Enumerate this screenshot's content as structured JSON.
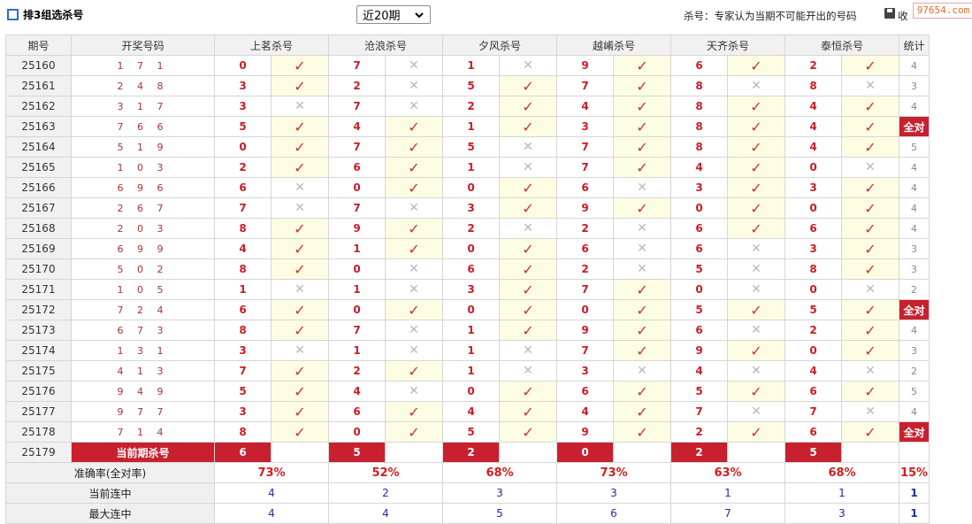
{
  "header": {
    "title": "排3组选杀号",
    "period_select": "近20期",
    "note": "杀号：专家认为当期不可能开出的号码",
    "truncated_text": "收",
    "watermark": "97654.com"
  },
  "table": {
    "col_issue": "期号",
    "col_draw": "开奖号码",
    "experts": [
      "上茗杀号",
      "沧浪杀号",
      "夕风杀号",
      "越崤杀号",
      "天齐杀号",
      "泰恒杀号"
    ],
    "col_stat": "统计",
    "rows": [
      {
        "issue": "25160",
        "draw": "1 7 1",
        "kills": [
          "0",
          "7",
          "1",
          "9",
          "6",
          "2"
        ],
        "ok": [
          true,
          false,
          false,
          true,
          true,
          true
        ],
        "stat": "4"
      },
      {
        "issue": "25161",
        "draw": "2 4 8",
        "kills": [
          "3",
          "2",
          "5",
          "7",
          "8",
          "8"
        ],
        "ok": [
          true,
          false,
          true,
          true,
          false,
          false
        ],
        "stat": "3"
      },
      {
        "issue": "25162",
        "draw": "3 1 7",
        "kills": [
          "3",
          "7",
          "2",
          "4",
          "8",
          "4"
        ],
        "ok": [
          false,
          false,
          true,
          true,
          true,
          true
        ],
        "stat": "4"
      },
      {
        "issue": "25163",
        "draw": "7 6 6",
        "kills": [
          "5",
          "4",
          "1",
          "3",
          "8",
          "4"
        ],
        "ok": [
          true,
          true,
          true,
          true,
          true,
          true
        ],
        "stat": "全对"
      },
      {
        "issue": "25164",
        "draw": "5 1 9",
        "kills": [
          "0",
          "7",
          "5",
          "7",
          "8",
          "4"
        ],
        "ok": [
          true,
          true,
          false,
          true,
          true,
          true
        ],
        "stat": "5"
      },
      {
        "issue": "25165",
        "draw": "1 0 3",
        "kills": [
          "2",
          "6",
          "1",
          "7",
          "4",
          "0"
        ],
        "ok": [
          true,
          true,
          false,
          true,
          true,
          false
        ],
        "stat": "4"
      },
      {
        "issue": "25166",
        "draw": "6 9 6",
        "kills": [
          "6",
          "0",
          "0",
          "6",
          "3",
          "3"
        ],
        "ok": [
          false,
          true,
          true,
          false,
          true,
          true
        ],
        "stat": "4"
      },
      {
        "issue": "25167",
        "draw": "2 6 7",
        "kills": [
          "7",
          "7",
          "3",
          "9",
          "0",
          "0"
        ],
        "ok": [
          false,
          false,
          true,
          true,
          true,
          true
        ],
        "stat": "4"
      },
      {
        "issue": "25168",
        "draw": "2 0 3",
        "kills": [
          "8",
          "9",
          "2",
          "2",
          "6",
          "6"
        ],
        "ok": [
          true,
          true,
          false,
          false,
          true,
          true
        ],
        "stat": "4"
      },
      {
        "issue": "25169",
        "draw": "6 9 9",
        "kills": [
          "4",
          "1",
          "0",
          "6",
          "6",
          "3"
        ],
        "ok": [
          true,
          true,
          true,
          false,
          false,
          true
        ],
        "stat": "3"
      },
      {
        "issue": "25170",
        "draw": "5 0 2",
        "kills": [
          "8",
          "0",
          "6",
          "2",
          "5",
          "8"
        ],
        "ok": [
          true,
          false,
          true,
          false,
          false,
          true
        ],
        "stat": "3"
      },
      {
        "issue": "25171",
        "draw": "1 0 5",
        "kills": [
          "1",
          "1",
          "3",
          "7",
          "0",
          "0"
        ],
        "ok": [
          false,
          false,
          true,
          true,
          false,
          false
        ],
        "stat": "2"
      },
      {
        "issue": "25172",
        "draw": "7 2 4",
        "kills": [
          "6",
          "0",
          "0",
          "0",
          "5",
          "5"
        ],
        "ok": [
          true,
          true,
          true,
          true,
          true,
          true
        ],
        "stat": "全对"
      },
      {
        "issue": "25173",
        "draw": "6 7 3",
        "kills": [
          "8",
          "7",
          "1",
          "9",
          "6",
          "2"
        ],
        "ok": [
          true,
          false,
          true,
          true,
          false,
          true
        ],
        "stat": "4"
      },
      {
        "issue": "25174",
        "draw": "1 3 1",
        "kills": [
          "3",
          "1",
          "1",
          "7",
          "9",
          "0"
        ],
        "ok": [
          false,
          false,
          false,
          true,
          true,
          true
        ],
        "stat": "3"
      },
      {
        "issue": "25175",
        "draw": "4 1 3",
        "kills": [
          "7",
          "2",
          "1",
          "3",
          "4",
          "4"
        ],
        "ok": [
          true,
          true,
          false,
          false,
          false,
          false
        ],
        "stat": "2"
      },
      {
        "issue": "25176",
        "draw": "9 4 9",
        "kills": [
          "5",
          "4",
          "0",
          "6",
          "5",
          "6"
        ],
        "ok": [
          true,
          false,
          true,
          true,
          true,
          true
        ],
        "stat": "5"
      },
      {
        "issue": "25177",
        "draw": "9 7 7",
        "kills": [
          "3",
          "6",
          "4",
          "4",
          "7",
          "7"
        ],
        "ok": [
          true,
          true,
          true,
          true,
          false,
          false
        ],
        "stat": "4"
      },
      {
        "issue": "25178",
        "draw": "7 1 4",
        "kills": [
          "8",
          "0",
          "5",
          "9",
          "2",
          "6"
        ],
        "ok": [
          true,
          true,
          true,
          true,
          true,
          true
        ],
        "stat": "全对"
      }
    ],
    "current": {
      "issue": "25179",
      "label": "当前期杀号",
      "kills": [
        "6",
        "5",
        "2",
        "0",
        "2",
        "5"
      ]
    },
    "summary": [
      {
        "label": "准确率(全对率)",
        "values": [
          "73%",
          "52%",
          "68%",
          "73%",
          "63%",
          "68%"
        ],
        "stat": "15%",
        "kind": "pct"
      },
      {
        "label": "当前连中",
        "values": [
          "4",
          "2",
          "3",
          "3",
          "1",
          "1"
        ],
        "stat": "1",
        "kind": "num"
      },
      {
        "label": "最大连中",
        "values": [
          "4",
          "4",
          "5",
          "6",
          "7",
          "3"
        ],
        "stat": "1",
        "kind": "num"
      }
    ]
  },
  "icons": {
    "ok": "check-mark-icon",
    "bad": "cross-mark-icon"
  },
  "colors": {
    "accent_red": "#c8202f",
    "tick_red": "#d23030",
    "ok_bg": "#fdfde3",
    "num_blue": "#1c2e9e"
  }
}
